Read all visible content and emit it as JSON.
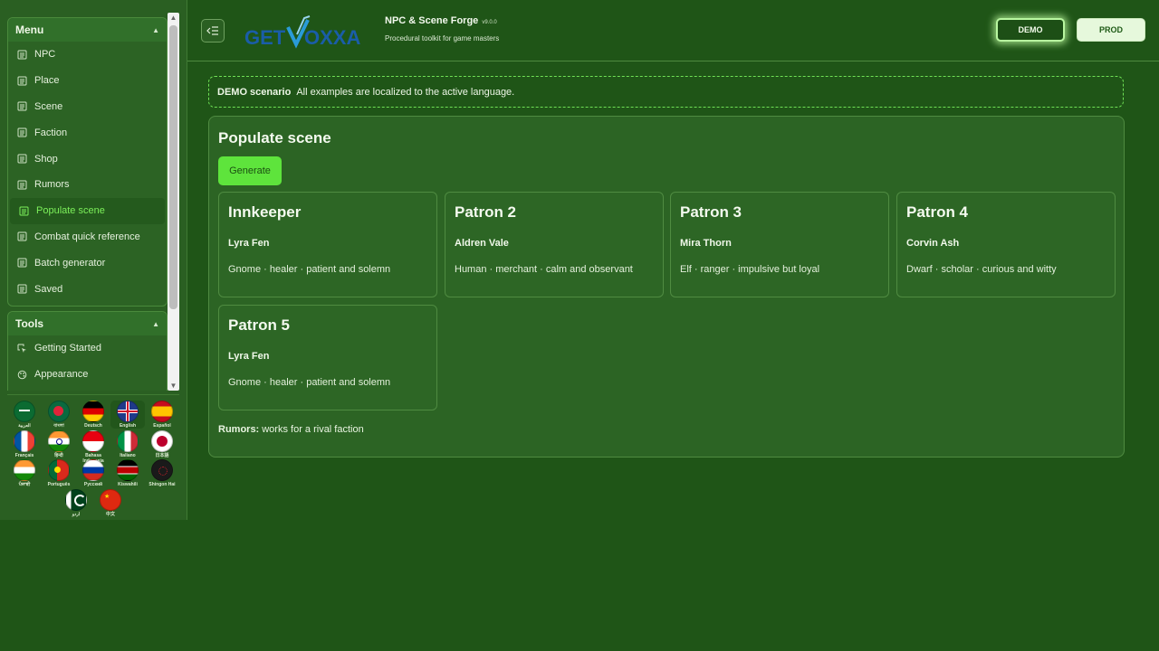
{
  "sidebar": {
    "menu_title": "Menu",
    "menu_items": [
      "NPC",
      "Place",
      "Scene",
      "Faction",
      "Shop",
      "Rumors",
      "Populate scene",
      "Combat quick reference",
      "Batch generator",
      "Saved"
    ],
    "active_item": "Populate scene",
    "tools_title": "Tools",
    "tools_items": [
      "Getting Started",
      "Appearance"
    ],
    "languages": [
      "العربية",
      "বাংলা",
      "Deutsch",
      "English",
      "Español",
      "Français",
      "हिन्दी",
      "Bahasa Indonesia",
      "Italiano",
      "日本語",
      "ਪੰਜਾਬੀ",
      "Português",
      "Русский",
      "Kiswahili",
      "Shingon Hai",
      "اردو",
      "中文"
    ],
    "selected_language": "English"
  },
  "header": {
    "logo_text": "GETVOXXA",
    "title": "NPC & Scene Forge",
    "version": "v9.0.0",
    "subtitle": "Procedural toolkit for game masters",
    "env_demo": "DEMO",
    "env_prod": "PROD"
  },
  "banner": {
    "label": "DEMO scenario",
    "text": "All examples are localized to the active language."
  },
  "scene": {
    "title": "Populate scene",
    "generate_label": "Generate",
    "npcs": [
      {
        "role": "Innkeeper",
        "name": "Lyra Fen",
        "desc": "Gnome · healer · patient and solemn"
      },
      {
        "role": "Patron 2",
        "name": "Aldren Vale",
        "desc": "Human · merchant · calm and observant"
      },
      {
        "role": "Patron 3",
        "name": "Mira Thorn",
        "desc": "Elf · ranger · impulsive but loyal"
      },
      {
        "role": "Patron 4",
        "name": "Corvin Ash",
        "desc": "Dwarf · scholar · curious and witty"
      },
      {
        "role": "Patron 5",
        "name": "Lyra Fen",
        "desc": "Gnome · healer · patient and solemn"
      }
    ],
    "rumors_label": "Rumors:",
    "rumors_text": "works for a rival faction"
  },
  "colors": {
    "background": "#1f5517",
    "sidebar": "#2a5f22",
    "accent": "#5ee43c",
    "active_text": "#7cf05a"
  }
}
